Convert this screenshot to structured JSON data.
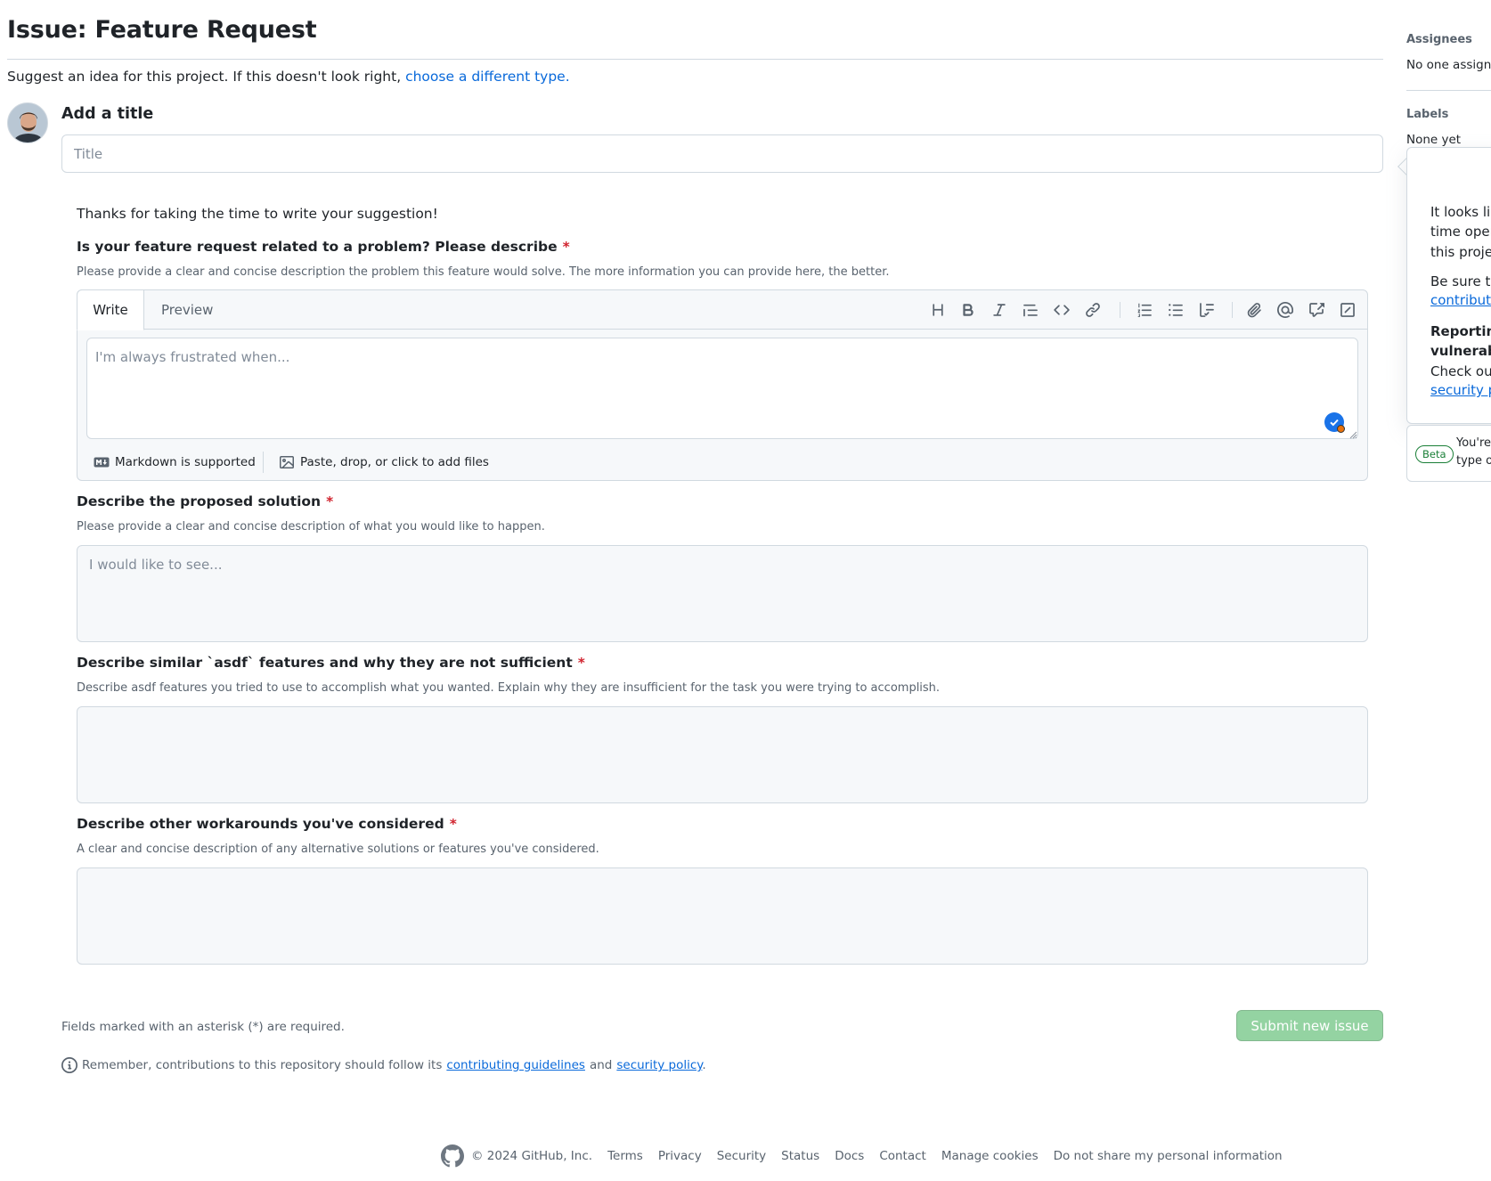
{
  "header": {
    "title": "Issue: Feature Request",
    "subtitle": "Suggest an idea for this project. If this doesn't look right,",
    "subtitle_link": "choose a different type."
  },
  "title_field": {
    "label": "Add a title",
    "placeholder": "Title",
    "value": ""
  },
  "form": {
    "intro": "Thanks for taking the time to write your suggestion!",
    "required_mark": "*",
    "fields": [
      {
        "label": "Is your feature request related to a problem? Please describe",
        "description": "Please provide a clear and concise description the problem this feature would solve. The more information you can provide here, the better.",
        "placeholder": "I'm always frustrated when...",
        "value": ""
      },
      {
        "label": "Describe the proposed solution",
        "description": "Please provide a clear and concise description of what you would like to happen.",
        "placeholder": "I would like to see...",
        "value": ""
      },
      {
        "label": "Describe similar `asdf` features and why they are not sufficient",
        "description": "Describe asdf features you tried to use to accomplish what you wanted. Explain why they are insufficient for the task you were trying to accomplish.",
        "placeholder": "",
        "value": ""
      },
      {
        "label": "Describe other workarounds you've considered",
        "description": "A clear and concise description of any alternative solutions or features you've considered.",
        "placeholder": "",
        "value": ""
      }
    ]
  },
  "editor": {
    "tabs": [
      "Write",
      "Preview"
    ],
    "active_tab": "Write",
    "toolbar_icons": [
      "heading-icon",
      "bold-icon",
      "italic-icon",
      "quote-icon",
      "code-icon",
      "link-icon",
      "ordered-list-icon",
      "unordered-list-icon",
      "task-list-icon",
      "attach-icon",
      "mention-icon",
      "reference-icon",
      "saved-replies-icon"
    ],
    "markdown_note": "Markdown is supported",
    "attach_note": "Paste, drop, or click to add files"
  },
  "footer_form": {
    "required_note": "Fields marked with an asterisk (*) are required.",
    "submit_label": "Submit new issue",
    "remember_prefix": "Remember, contributions to this repository should follow its",
    "contributing_link": "contributing guidelines",
    "and_text": "and",
    "security_link": "security policy",
    "period": "."
  },
  "sidebar": {
    "assignees_heading": "Assignees",
    "assignees_value": "No one assigne",
    "labels_heading": "Labels",
    "labels_value": "None yet",
    "popover": {
      "line1": "It looks lik",
      "line2": "time oper",
      "line3": "this proje",
      "line4": "Be sure to",
      "link1": "contributi",
      "bold1": "Reporting",
      "bold2": "vulnerabi",
      "line5": "Check out",
      "link2": "security p"
    },
    "beta": {
      "badge": "Beta",
      "line1": "You're",
      "line2": "type o"
    }
  },
  "page_footer": {
    "copyright": "© 2024 GitHub, Inc.",
    "links": [
      "Terms",
      "Privacy",
      "Security",
      "Status",
      "Docs",
      "Contact",
      "Manage cookies",
      "Do not share my personal information"
    ]
  },
  "colors": {
    "link": "#0969da",
    "required": "#d1242f",
    "submit_disabled": "#94d3a2",
    "border": "#d1d9e0"
  }
}
